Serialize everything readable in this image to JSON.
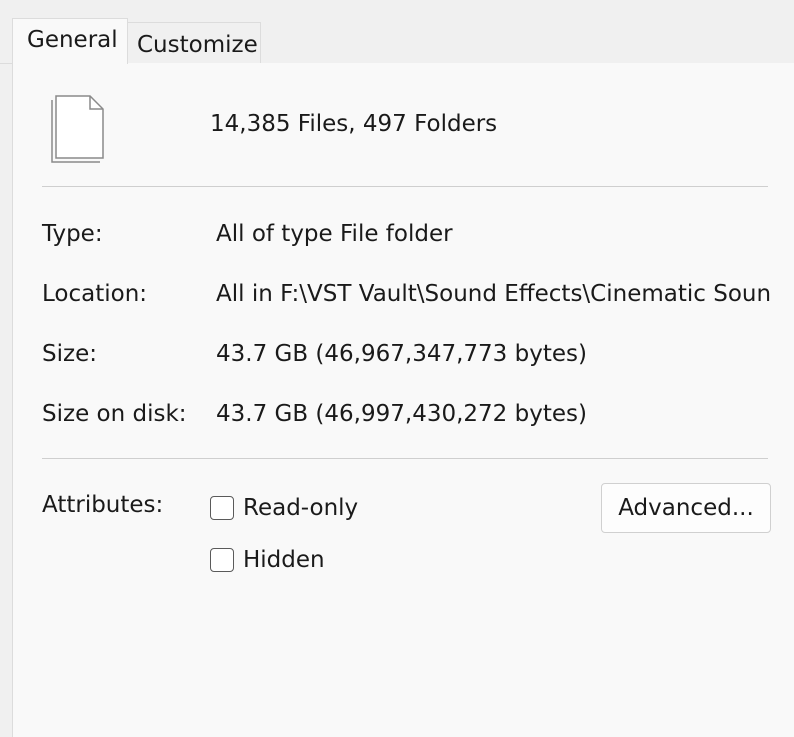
{
  "tabs": [
    {
      "label": "General",
      "active": true
    },
    {
      "label": "Customize",
      "active": false
    }
  ],
  "summary": {
    "icon": "document-stack-icon",
    "text": "14,385 Files, 497 Folders"
  },
  "properties": [
    {
      "label": "Type:",
      "value": "All of type File folder"
    },
    {
      "label": "Location:",
      "value": "All in F:\\VST Vault\\Sound Effects\\Cinematic Sound I"
    },
    {
      "label": "Size:",
      "value": "43.7 GB (46,967,347,773 bytes)"
    },
    {
      "label": "Size on disk:",
      "value": "43.7 GB (46,997,430,272 bytes)"
    }
  ],
  "attributes": {
    "label": "Attributes:",
    "read_only": {
      "label": "Read-only",
      "checked": false
    },
    "hidden": {
      "label": "Hidden",
      "checked": false
    },
    "advanced_button": "Advanced..."
  }
}
